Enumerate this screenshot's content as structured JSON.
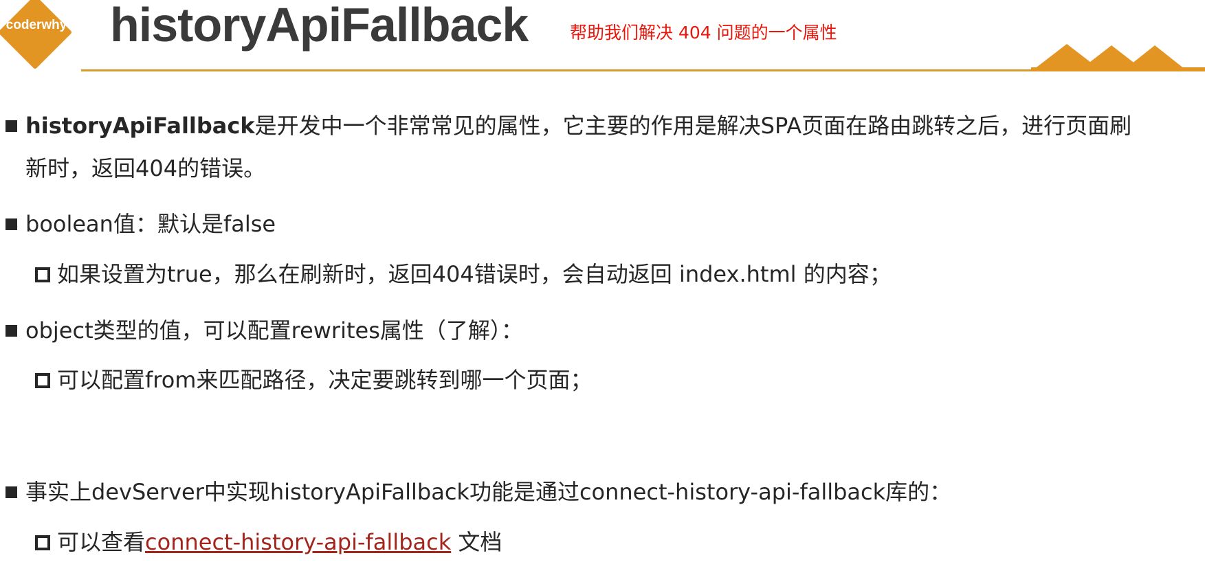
{
  "header": {
    "logo_text": "coderwhy",
    "title": "historyApiFallback",
    "annotation": "帮助我们解决 404 问题的一个属性",
    "accent_color": "#d49a2a",
    "annotation_color": "#e8170c"
  },
  "content": {
    "item1": {
      "bold": "historyApiFallback",
      "line1_rest": "是开发中一个非常常见的属性，它主要的作用是解决SPA页面在路由跳转之后，进行页面刷",
      "line2": "新时，返回404的错误。"
    },
    "item2": {
      "text": "boolean值：默认是false",
      "sub1": "如果设置为true，那么在刷新时，返回404错误时，会自动返回 index.html 的内容；"
    },
    "item3": {
      "text": "object类型的值，可以配置rewrites属性（了解）：",
      "sub1": "可以配置from来匹配路径，决定要跳转到哪一个页面；"
    },
    "item4": {
      "text": "事实上devServer中实现historyApiFallback功能是通过connect-history-api-fallback库的：",
      "sub_prefix": "可以查看",
      "sub_link": "connect-history-api-fallback",
      "sub_suffix": " 文档",
      "link_color": "#a3251c"
    }
  }
}
